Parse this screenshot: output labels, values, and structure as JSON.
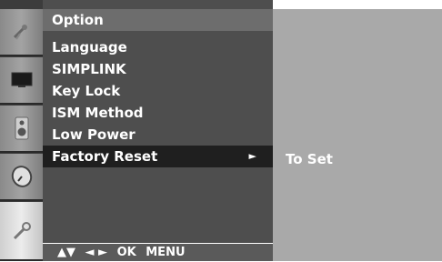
{
  "menu": {
    "title": "Option",
    "items": [
      {
        "label": "Language"
      },
      {
        "label": "SIMPLINK"
      },
      {
        "label": "Key Lock"
      },
      {
        "label": "ISM Method"
      },
      {
        "label": "Low Power"
      },
      {
        "label": "Factory Reset",
        "selected": true
      }
    ],
    "selected_arrow": "►"
  },
  "submenu": {
    "value": "To Set"
  },
  "footer": {
    "nav_updown": "▲▼",
    "nav_leftright": "◄ ►",
    "ok": "OK",
    "menu": "MENU"
  },
  "icons": [
    {
      "name": "satellite-dish-icon"
    },
    {
      "name": "screen-picture-icon"
    },
    {
      "name": "speaker-audio-icon"
    },
    {
      "name": "clock-time-icon"
    },
    {
      "name": "wrench-option-icon",
      "active": true
    }
  ],
  "colors": {
    "menu_bg": "#4e4e4e",
    "title_bg": "#6d6d6d",
    "selected_bg": "#1f1f1f",
    "submenu_bg": "#a9a9a9",
    "text": "#ffffff"
  }
}
